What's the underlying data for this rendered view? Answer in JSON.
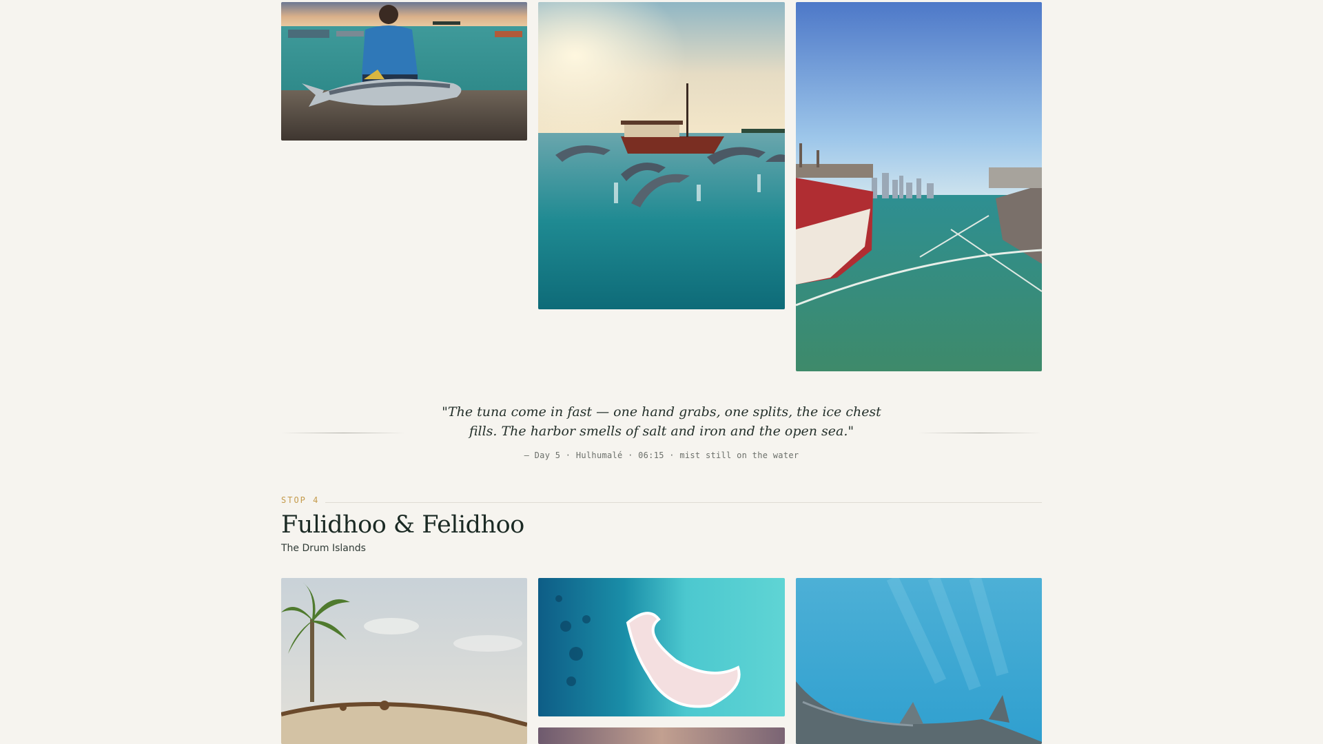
{
  "gallery_top": {
    "photos": [
      {
        "subject": "fisherman filleting tuna at harbor"
      },
      {
        "subject": "dolphins leaping near boat at sunrise"
      },
      {
        "subject": "harbor with moored boats and city skyline"
      }
    ]
  },
  "quote": {
    "text": "\"The tuna come in fast — one hand grabs, one splits, the ice chest fills. The harbor smells of salt and iron and the open sea.\"",
    "caption": "— Day 5 · Hulhumalé · 06:15 · mist still on the water"
  },
  "stop": {
    "label": "STOP 4",
    "title": "Fulidhoo & Felidhoo",
    "subtitle": "The Drum Islands"
  },
  "gallery_bottom": {
    "photos": [
      {
        "subject": "palm tree and bodu beru drum"
      },
      {
        "subject": "aerial view of sandbank in turquoise lagoon"
      },
      {
        "subject": "nurse shark swimming underwater"
      },
      {
        "subject": "sunset sky"
      }
    ]
  },
  "colors": {
    "background": "#f6f4ef",
    "accent": "#c49a4a",
    "text": "#1b2a24"
  }
}
